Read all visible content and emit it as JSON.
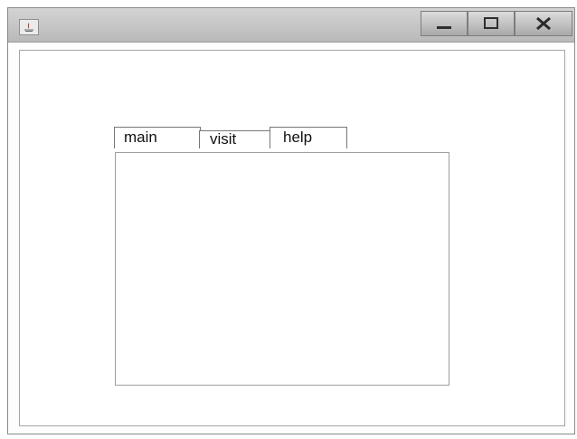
{
  "window": {
    "tabs": [
      {
        "label": "main"
      },
      {
        "label": "visit"
      },
      {
        "label": "help"
      }
    ],
    "controls": {
      "minimize": "minimize-icon",
      "maximize": "maximize-icon",
      "close": "close-icon"
    }
  }
}
